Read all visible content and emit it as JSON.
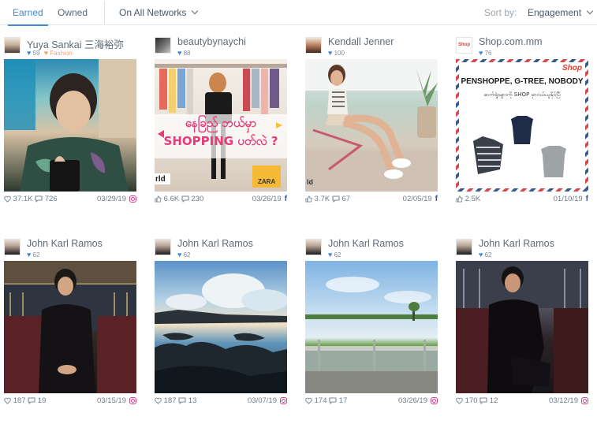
{
  "tabs": [
    {
      "label": "Earned",
      "active": true
    },
    {
      "label": "Owned",
      "active": false
    }
  ],
  "filter": {
    "networks_label": "On All Networks"
  },
  "sort": {
    "label": "Sort by:",
    "value": "Engagement"
  },
  "colors": {
    "accent": "#3c8ad8",
    "instagram": "#d8418c",
    "facebook": "#3b5998",
    "tag": "#f0a27a"
  },
  "posts": [
    {
      "author": "Yuya Sankai 三海裕弥",
      "followers": "59",
      "tag": "Fashion",
      "likes": "37.1K",
      "comments": "726",
      "date": "03/29/19",
      "network": "instagram-icon"
    },
    {
      "author": "beautybynaychi",
      "followers": "88",
      "tag": "",
      "likes": "6.6K",
      "comments": "230",
      "date": "03/26/19",
      "network": "facebook-icon",
      "overlay_text": "နေခြည် ဘယ်မှာ SHOPPING ပတ်လဲ ?",
      "brand": "ZARA",
      "corner": "rld"
    },
    {
      "author": "Kendall Jenner",
      "followers": "100",
      "tag": "",
      "likes": "3.7K",
      "comments": "67",
      "date": "02/05/19",
      "network": "facebook-icon",
      "corner": "ld"
    },
    {
      "author": "Shop.com.mm",
      "followers": "76",
      "tag": "",
      "likes": "2.5K",
      "comments": "",
      "date": "01/10/19",
      "network": "facebook-icon",
      "headline": "PENSHOPPE, G-TREE, NOBODY",
      "subline": "ဆက်ရှုံးများကို SHOP မှာဝယ်ယူနိုင်ပြီ",
      "logo": "Shop"
    },
    {
      "author": "John Karl Ramos",
      "followers": "62",
      "tag": "",
      "likes": "187",
      "comments": "19",
      "date": "03/15/19",
      "network": "instagram-icon"
    },
    {
      "author": "John Karl Ramos",
      "followers": "62",
      "tag": "",
      "likes": "187",
      "comments": "13",
      "date": "03/07/19",
      "network": "instagram-icon"
    },
    {
      "author": "John Karl Ramos",
      "followers": "62",
      "tag": "",
      "likes": "174",
      "comments": "17",
      "date": "03/26/19",
      "network": "instagram-icon"
    },
    {
      "author": "John Karl Ramos",
      "followers": "62",
      "tag": "",
      "likes": "170",
      "comments": "12",
      "date": "03/12/19",
      "network": "instagram-icon"
    }
  ]
}
